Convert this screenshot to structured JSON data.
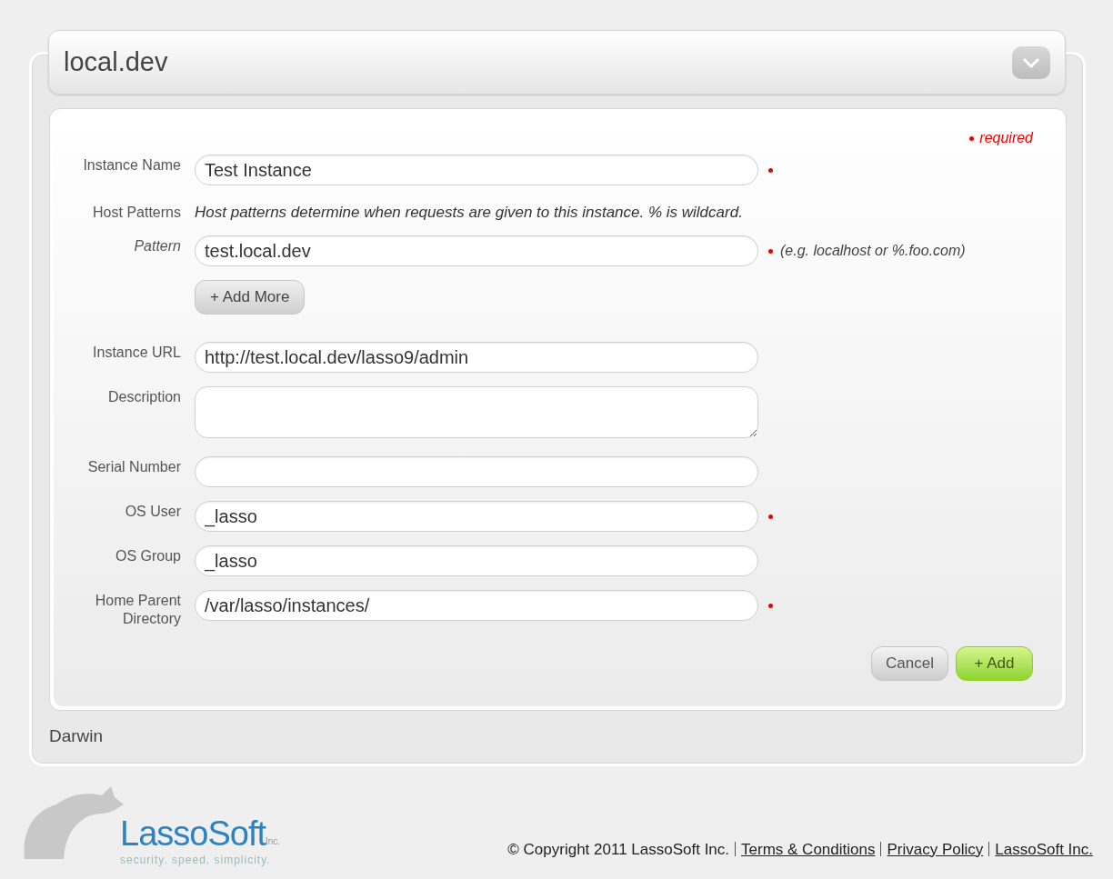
{
  "header": {
    "title": "local.dev"
  },
  "form": {
    "required_legend": "required",
    "rows": [
      {
        "kind": "field",
        "label": "Instance Name",
        "value": "Test Instance",
        "required": true
      },
      {
        "kind": "note",
        "label": "Host Patterns",
        "text": "Host patterns determine when requests are given to this instance. % is wildcard."
      },
      {
        "kind": "subfield",
        "label": "Pattern",
        "value": "test.local.dev",
        "required": true,
        "hint": "(e.g. localhost or %.foo.com)"
      },
      {
        "kind": "button",
        "label": "+ Add More"
      },
      {
        "kind": "field",
        "label": "Instance URL",
        "value": "http://test.local.dev/lasso9/admin",
        "required": false
      },
      {
        "kind": "textarea",
        "label": "Description",
        "value": "",
        "required": false
      },
      {
        "kind": "field",
        "label": "Serial Number",
        "value": "",
        "required": false
      },
      {
        "kind": "field",
        "label": "OS User",
        "value": "_lasso",
        "required": true
      },
      {
        "kind": "field",
        "label": "OS Group",
        "value": "_lasso",
        "required": false
      },
      {
        "kind": "field",
        "label": "Home Parent Directory",
        "value": "/var/lasso/instances/",
        "required": true
      }
    ],
    "buttons": [
      {
        "kind": "cancel",
        "label": "Cancel"
      },
      {
        "kind": "primary",
        "label": "+ Add"
      }
    ]
  },
  "platform": "Darwin",
  "logo": {
    "name": "LassoSoft",
    "suffix": "Inc.",
    "tagline": "security. speed. simplicity."
  },
  "footer": {
    "copyright": "© Copyright 2011 LassoSoft Inc.",
    "links": [
      "Terms & Conditions",
      "Privacy Policy",
      "LassoSoft Inc."
    ]
  }
}
